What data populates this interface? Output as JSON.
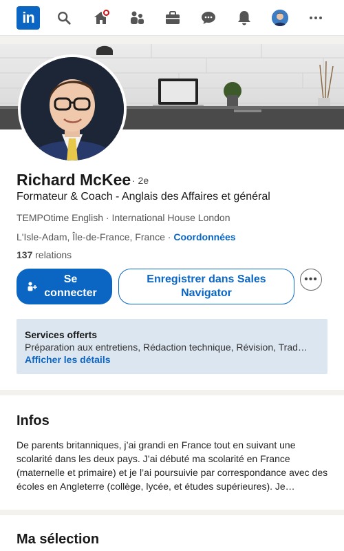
{
  "nav": {
    "logo": "in",
    "icons": [
      "search-icon",
      "home-icon",
      "network-icon",
      "jobs-icon",
      "messaging-icon",
      "notifications-icon",
      "me-avatar",
      "more-icon"
    ]
  },
  "profile": {
    "name": "Richard McKee",
    "degree": "· 2e",
    "headline": "Formateur & Coach - Anglais des Affaires et général",
    "company": "TEMPOtime English · International House London",
    "location": "L'Isle-Adam, Île-de-France, France",
    "location_sep": " · ",
    "contact_link": "Coordonnées",
    "relations_count": "137",
    "relations_label": " relations"
  },
  "actions": {
    "connect": "Se connecter",
    "save_sales_navigator": "Enregistrer dans Sales Navigator",
    "more": "•••"
  },
  "services": {
    "title": "Services offerts",
    "description": "Préparation aux entretiens, Rédaction technique, Révision, Trad…",
    "link": "Afficher les détails"
  },
  "infos": {
    "title": "Infos",
    "text": "De parents britanniques, j’ai grandi en France tout en suivant une scolarité dans les deux pays. J’ai débuté ma scolarité en France (maternelle et primaire) et je l’ai poursuivie par correspondance avec des écoles en Angleterre (collège, lycée, et études supérieures). Je…"
  },
  "selection": {
    "title": "Ma sélection"
  },
  "colors": {
    "brand": "#0a66c2",
    "notification_badge": "#cc1016",
    "services_bg": "#dce6f1"
  }
}
